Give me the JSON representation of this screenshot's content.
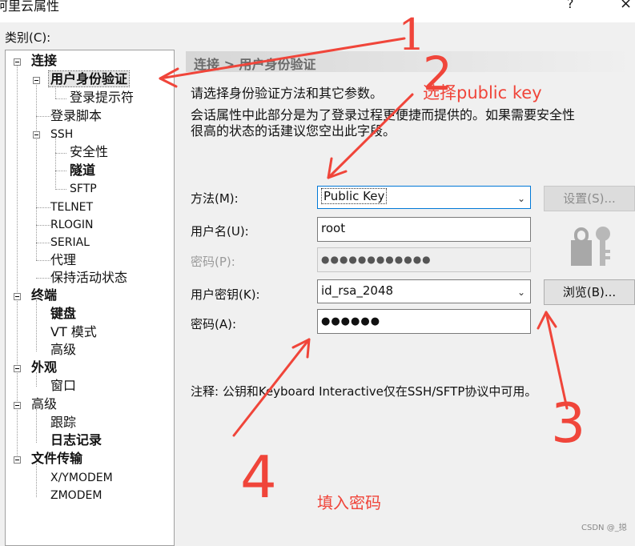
{
  "window": {
    "title": "阿里云属性",
    "help": "?",
    "close": "×"
  },
  "category_label": "类别(C):",
  "tree": {
    "connection": "连接",
    "user_auth": "用户身份验证",
    "login_prompt": "登录提示符",
    "login_script": "登录脚本",
    "ssh": "SSH",
    "security": "安全性",
    "tunnel": "隧道",
    "sftp": "SFTP",
    "telnet": "TELNET",
    "rlogin": "RLOGIN",
    "serial": "SERIAL",
    "proxy": "代理",
    "keepalive": "保持活动状态",
    "terminal": "终端",
    "keyboard": "键盘",
    "vt_mode": "VT 模式",
    "advanced_term": "高级",
    "appearance": "外观",
    "window": "窗口",
    "advanced": "高级",
    "trace": "跟踪",
    "logging": "日志记录",
    "file_transfer": "文件传输",
    "xymodem": "X/YMODEM",
    "zmodem": "ZMODEM"
  },
  "main": {
    "breadcrumb": "连接 > 用户身份验证",
    "para1": "请选择身份验证方法和其它参数。",
    "para2": "会话属性中此部分是为了登录过程更便捷而提供的。如果需要安全性",
    "para3": "很高的状态的话建议您空出此字段。",
    "method_label": "方法(M):",
    "method_value": "Public Key",
    "settings_button": "设置(S)...",
    "username_label": "用户名(U):",
    "username_value": "root",
    "password_label": "密码(P):",
    "password_value": "●●●●●●●●●●●●",
    "userkey_label": "用户密钥(K):",
    "userkey_value": "id_rsa_2048",
    "browse_button": "浏览(B)...",
    "passphrase_label": "密码(A):",
    "passphrase_value": "●●●●●●",
    "note": "注释: 公钥和Keyboard Interactive仅在SSH/SFTP协议中可用。"
  },
  "annotations": {
    "a1": "1",
    "a2": "2",
    "a2_text": "选择public key",
    "a3": "3",
    "a4": "4",
    "a4_text": "填入密码",
    "color": "#f0453a"
  },
  "watermark": "CSDN @_搃"
}
